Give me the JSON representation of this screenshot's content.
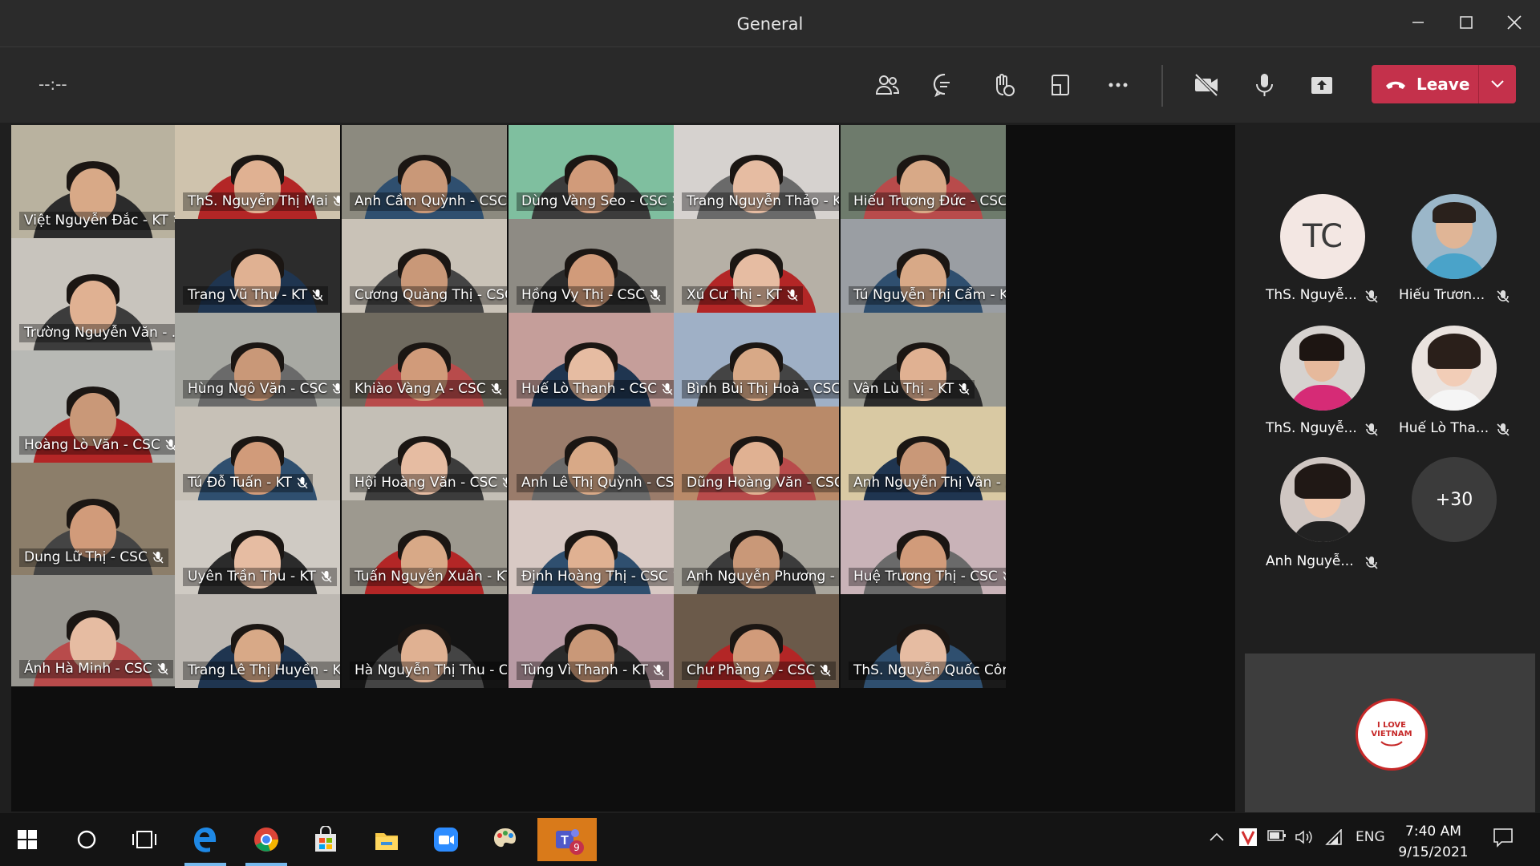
{
  "window": {
    "title": "General"
  },
  "meeting": {
    "timer": "--:--",
    "leave_label": "Leave",
    "accent": "#c4314b"
  },
  "grid_tiles": [
    {
      "name": "Việt Nguyễn Đắc - KT"
    },
    {
      "name": "ThS. Nguyễn Thị Mai"
    },
    {
      "name": "Anh Cầm Quỳnh - CSC"
    },
    {
      "name": "Dùng Vàng Seo - CSC"
    },
    {
      "name": "Trang Nguyễn Thảo - KT"
    },
    {
      "name": "Hiếu Trương Đức - CSC"
    },
    {
      "name": "Trang Vũ Thu - KT"
    },
    {
      "name": "Cương Quàng Thị - CSC"
    },
    {
      "name": "Hồng Vy Thị - CSC"
    },
    {
      "name": "Xú Cư Thị - KT"
    },
    {
      "name": "Tú Nguyễn Thị Cẩm - KT"
    },
    {
      "name": "Trường Nguyễn Văn - ..."
    },
    {
      "name": "Hùng Ngô Văn - CSC"
    },
    {
      "name": "Khiào Vàng A - CSC"
    },
    {
      "name": "Huế Lò Thanh - CSC"
    },
    {
      "name": "Bình Bùi Thị Hoà - CSC"
    },
    {
      "name": "Vân Lù Thị - KT"
    },
    {
      "name": "Hoàng Lò Văn - CSC"
    },
    {
      "name": "Tú Đỗ Tuấn - KT"
    },
    {
      "name": "Hội Hoàng Văn - CSC"
    },
    {
      "name": "Anh Lê Thị Quỳnh - CSC"
    },
    {
      "name": "Dũng Hoàng Văn - CSC"
    },
    {
      "name": "Anh Nguyễn Thị Vân - ..."
    },
    {
      "name": "Dung Lữ Thị - CSC"
    },
    {
      "name": "Uyên Trần Thu - KT"
    },
    {
      "name": "Tuấn Nguyễn Xuân - KT"
    },
    {
      "name": "Định Hoàng Thị - CSC"
    },
    {
      "name": "Anh Nguyễn Phương - ..."
    },
    {
      "name": "Huệ Trương Thị - CSC"
    },
    {
      "name": "Ánh Hà Minh - CSC"
    },
    {
      "name": "Trang Lê Thị Huyền - KT"
    },
    {
      "name": "Hà Nguyễn Thị Thu - C..."
    },
    {
      "name": "Tùng Vì Thanh - KT"
    },
    {
      "name": "Chư Phàng A - CSC"
    },
    {
      "name": "ThS. Nguyễn Quốc Công"
    }
  ],
  "side_participants": [
    {
      "name": "ThS. Nguyễ...",
      "initials": "TC"
    },
    {
      "name": "Hiếu Trươn..."
    },
    {
      "name": "ThS. Nguyễ..."
    },
    {
      "name": "Huế Lò Tha..."
    },
    {
      "name": "Anh Nguyễ..."
    }
  ],
  "overflow_count": "+30",
  "self_view": {
    "logo_line1": "I LOVE",
    "logo_line2": "VIETNAM"
  },
  "taskbar": {
    "language": "ENG",
    "time": "7:40 AM",
    "date": "9/15/2021",
    "teams_badge": "9"
  }
}
